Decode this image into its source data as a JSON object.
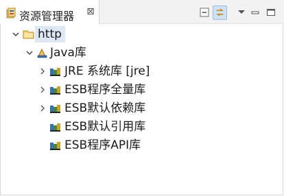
{
  "view": {
    "title": "资源管理器",
    "close_glyph": "⊠",
    "tab_icon": "package-explorer-icon",
    "toolbar": {
      "collapse_icon": "collapse-all-icon",
      "link_icon": "link-with-editor-icon",
      "menu_icon": "view-menu-icon",
      "minimize_icon": "minimize-icon",
      "maximize_icon": "maximize-icon"
    }
  },
  "tree": {
    "project": {
      "label": "http",
      "expanded": true,
      "selected": true,
      "icon": "project-folder-icon"
    },
    "java_lib": {
      "label": "Java库",
      "expanded": true,
      "icon": "java-library-icon"
    },
    "libraries": [
      {
        "label": "JRE 系统库 [jre]",
        "expandable": true,
        "icon": "jar-library-icon"
      },
      {
        "label": "ESB程序全量库",
        "expandable": true,
        "icon": "jar-library-icon"
      },
      {
        "label": "ESB默认依赖库",
        "expandable": true,
        "icon": "jar-library-icon"
      },
      {
        "label": "ESB默认引用库",
        "expandable": false,
        "icon": "jar-library-icon"
      },
      {
        "label": "ESB程序API库",
        "expandable": false,
        "icon": "jar-library-icon"
      }
    ]
  },
  "colors": {
    "selection": "#dde8f5",
    "header_bg": "#f2f2f2",
    "link_active": "#cfe1f5"
  }
}
